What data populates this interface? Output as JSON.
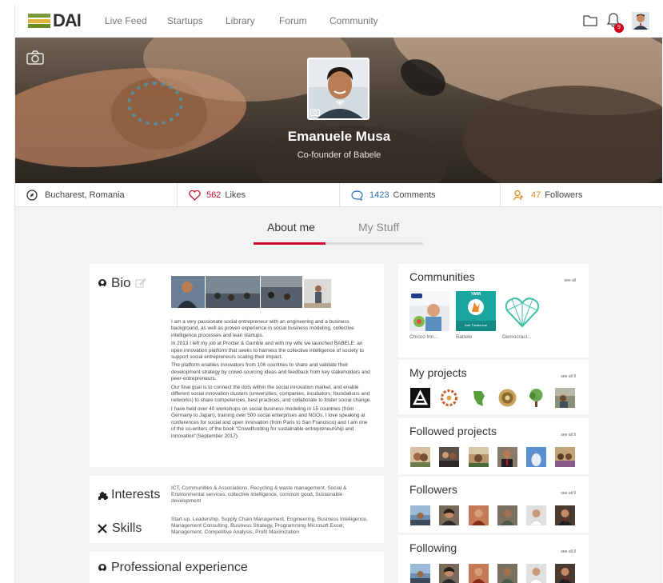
{
  "nav": {
    "logo_text": "DAI",
    "links": [
      "Live Feed",
      "Startups",
      "Library",
      "Forum",
      "Community"
    ],
    "notification_count": "9",
    "icons": [
      "folder-icon",
      "bell-icon",
      "user-avatar"
    ]
  },
  "profile": {
    "name": "Emanuele Musa",
    "role": "Co-founder of Babele"
  },
  "stats": {
    "location": "Bucharest, Romania",
    "likes_count": "562",
    "likes_label": "Likes",
    "comments_count": "1423",
    "comments_label": "Comments",
    "followers_count": "47",
    "followers_label": "Followers"
  },
  "tabs": {
    "active": "About me",
    "other": "My Stuff"
  },
  "bio": {
    "title": "Bio",
    "paragraphs": [
      "I am a very passionate social entrepreneur with an engineering and a business background, as well as proven experience in social business modeling, collective intelligence processes and lean startups.",
      "In 2013 I left my job at Procter & Gamble and with my wife we launched BABELE: an open innovation platform that seeks to harness the collective intelligence of society to support social entrepreneurs scaling their impact.",
      "The platform enables innovators from 106 countries to share and validate their development strategy by crowd-sourcing ideas and feedback from key stakeholders and peer-entrepreneurs.",
      "Our final goal is to connect the dots within the social innovation market, and enable different social innovation clusters (universities, companies, incubators, foundations and networks) to share competences, best practices, and collaborate to foster social change.",
      "I have held over 40 workshops on social business modeling in 15 countries (from Germany to Japan), training over 500 social enterprises and NGOs. I love speaking at conferences for social and open innovation (from Paris to San Francisco) and I am one of the co-writers of the book \"Crowdfunding for sustainable entrepreneurship and innovation\"(September 2017)."
    ]
  },
  "interests": {
    "title": "Interests",
    "text": "ICT, Communities & Associations, Recycling & waste management, Social & Environmental services, collective intelligence, common good, Sustainable development"
  },
  "skills": {
    "title": "Skills",
    "text": "Start-up, Leadership, Supply Chain Management, Engineering, Business Intelligence, Management Consulting, Business Strategy, Programming Microsoft Excel, Management, Competitive Analysis, Profit Maximization"
  },
  "experience": {
    "title": "Professional experience"
  },
  "communities": {
    "title": "Communities",
    "see_all": "see all",
    "items": [
      "Chicco inn...",
      "Babele",
      "Democraci..."
    ],
    "babele_tile_text": "YAWi",
    "babele_tile_sub": "Arte Tradicional"
  },
  "my_projects": {
    "title": "My projects",
    "see_all": "see all 9"
  },
  "followed_projects": {
    "title": "Followed projects",
    "see_all": "see all 9"
  },
  "followers": {
    "title": "Followers",
    "see_all": "see all 9"
  },
  "following": {
    "title": "Following",
    "see_all": "see all 9"
  },
  "colors": {
    "accent": "#c8102e",
    "logo_green": "#6b8e23",
    "logo_yellow": "#e2b43a",
    "babele_teal": "#1aa5a0"
  }
}
